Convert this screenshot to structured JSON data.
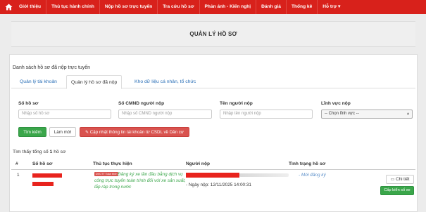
{
  "nav": {
    "items": [
      "Giới thiệu",
      "Thủ tục hành chính",
      "Nộp hồ sơ trực tuyến",
      "Tra cứu hồ sơ",
      "Phản ánh - Kiến nghị",
      "Đánh giá",
      "Thống kê",
      "Hỗ trợ ▾"
    ],
    "icon": "home-icon"
  },
  "page": {
    "title": "QUẢN LÝ HỒ SƠ"
  },
  "panel": {
    "heading": "Danh sách hồ sơ đã nộp trực tuyến"
  },
  "tabs": [
    "Quản lý tài khoản",
    "Quản lý hồ sơ đã nộp",
    "Kho dữ liệu cá nhân, tổ chức"
  ],
  "filters": {
    "so_ho_so": {
      "label": "Số hồ sơ",
      "placeholder": "Nhập số hồ sơ"
    },
    "cmnd": {
      "label": "Số CMND người nộp",
      "placeholder": "Nhập số CMND người nộp"
    },
    "ten": {
      "label": "Tên người nộp",
      "placeholder": "Nhập tên người nộp"
    },
    "linh_vuc": {
      "label": "Lĩnh vực nộp",
      "selected": "-- Chọn lĩnh vực --"
    }
  },
  "buttons": {
    "search": "Tìm kiếm",
    "reset": "Làm mới",
    "update": "Cập nhật thông tin tài khoản từ CSDL về Dân cư",
    "detail": "Chi tiết",
    "issue_plate": "Cấp biển số xe"
  },
  "result": {
    "prefix": "Tìm thấy tổng số",
    "count": "1",
    "suffix": "hồ sơ"
  },
  "table": {
    "headers": [
      "#",
      "Số hồ sơ",
      "Thủ tục thực hiện",
      "Người nộp",
      "Tình trạng hồ sơ"
    ],
    "rows": [
      {
        "index": "1",
        "badge": "DVCTT Toàn trình",
        "procedure": "Đăng ký xe lần đầu bằng dịch vụ công trực tuyến toàn trình đối với xe sản xuất, lắp ráp trong nước",
        "submitted": "- Ngày nộp: 12/11/2025 14:00:31",
        "status": "- Mới đăng ký"
      }
    ]
  },
  "colors": {
    "nav": "#d8211b",
    "green": "#3aa64a",
    "red": "#d9534f",
    "link": "#2a6fb7"
  }
}
